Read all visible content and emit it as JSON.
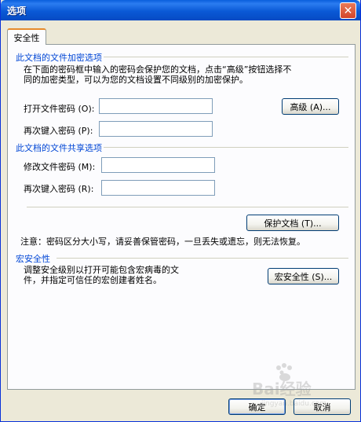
{
  "window": {
    "title": "选项",
    "close_glyph": "✕"
  },
  "tabs": [
    {
      "label": "安全性",
      "selected": true
    }
  ],
  "encryption": {
    "heading": "此文档的文件加密选项",
    "description_line1": "在下面的密码框中输入的密码会保护您的文档，点击“高级”按钮选择不",
    "description_line2": "同的加密类型，可以为您的文档设置不同级别的加密保护。",
    "open_password_label": "打开文件密码 (O):",
    "open_password_value": "",
    "reenter_open_label": "再次键入密码 (P):",
    "reenter_open_value": "",
    "advanced_button": "高级 (A)..."
  },
  "sharing": {
    "heading": "此文档的文件共享选项",
    "modify_password_label": "修改文件密码 (M):",
    "modify_password_value": "",
    "reenter_modify_label": "再次键入密码 (R):",
    "reenter_modify_value": "",
    "protect_button": "保护文档 (T)..."
  },
  "note": "注意：密码区分大小写，请妥善保管密码，一旦丢失或遗忘，则无法恢复。",
  "macro": {
    "heading": "宏安全性",
    "description_line1": "调整安全级别以打开可能包含宏病毒的文",
    "description_line2": "件，并指定可信任的宏创建者姓名。",
    "button": "宏安全性 (S)..."
  },
  "footer": {
    "ok_button": "确定",
    "cancel_button": "取消"
  },
  "watermark": {
    "text": "Bai经验",
    "subtext": "jingyan.baidu.com"
  },
  "colors": {
    "titlebar": "#0a59d6",
    "group_heading": "#0046d5",
    "window_bg": "#ece9d8",
    "tab_accent": "#e68b2c"
  }
}
